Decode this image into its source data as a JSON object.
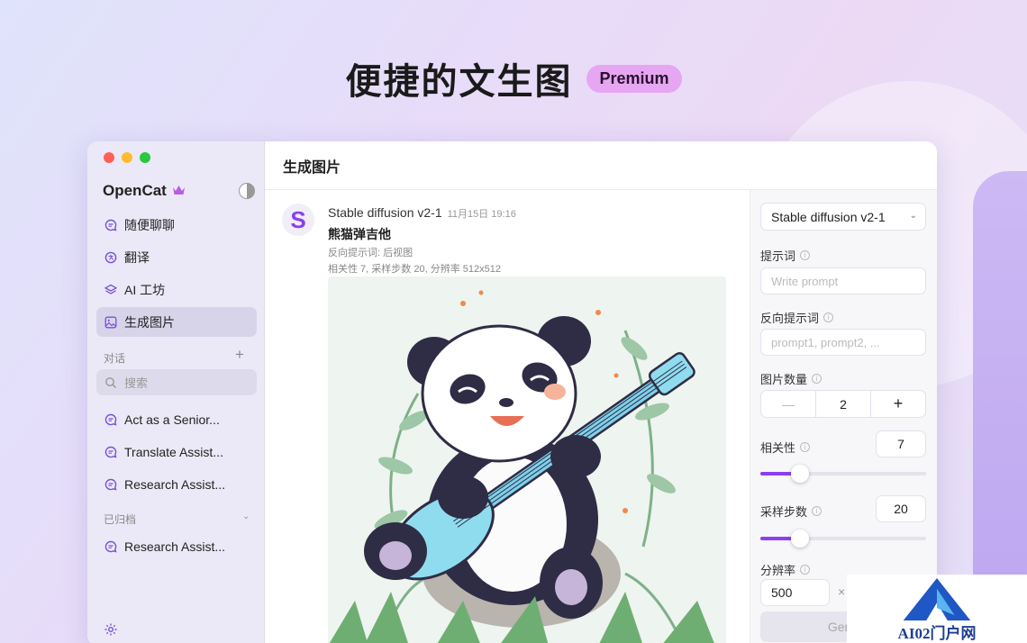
{
  "hero": {
    "title": "便捷的文生图",
    "badge": "Premium"
  },
  "sidebar": {
    "app_name": "OpenCat",
    "nav": [
      {
        "label": "随便聊聊",
        "icon": "chat-bubble-icon"
      },
      {
        "label": "翻译",
        "icon": "translate-icon"
      },
      {
        "label": "AI 工坊",
        "icon": "layers-icon"
      },
      {
        "label": "生成图片",
        "icon": "image-icon",
        "active": true
      }
    ],
    "conversations_label": "对话",
    "search_placeholder": "搜索",
    "conversations": [
      {
        "label": "Act as a Senior..."
      },
      {
        "label": "Translate Assist..."
      },
      {
        "label": "Research Assist..."
      }
    ],
    "archived_label": "已归档",
    "archived": [
      {
        "label": "Research Assist..."
      }
    ]
  },
  "main": {
    "title": "生成图片",
    "message": {
      "avatar_letter": "S",
      "model": "Stable diffusion v2-1",
      "time": "11月15日 19:16",
      "prompt": "熊猫弹吉他",
      "negative_prompt": "反向提示词: 后视图",
      "params": "相关性 7, 采样步数 20, 分辨率 512x512"
    }
  },
  "panel": {
    "model_select": "Stable diffusion v2-1",
    "prompt_label": "提示词",
    "prompt_placeholder": "Write prompt",
    "negative_label": "反向提示词",
    "negative_placeholder": "prompt1, prompt2, ...",
    "count_label": "图片数量",
    "count_value": "2",
    "count_minus": "—",
    "count_plus": "+",
    "relevance_label": "相关性",
    "relevance_value": "7",
    "relevance_fraction": 0.24,
    "steps_label": "采样步数",
    "steps_value": "20",
    "steps_fraction": 0.24,
    "resolution_label": "分辨率",
    "resolution_value": "500",
    "resolution_x": "×",
    "generate_label": "Gene"
  },
  "watermark": {
    "text": "AI02门户网"
  },
  "colors": {
    "accent": "#8b3ff0",
    "badge": "#e6a6f2",
    "sidebar_bg": "#ebe9f7"
  }
}
